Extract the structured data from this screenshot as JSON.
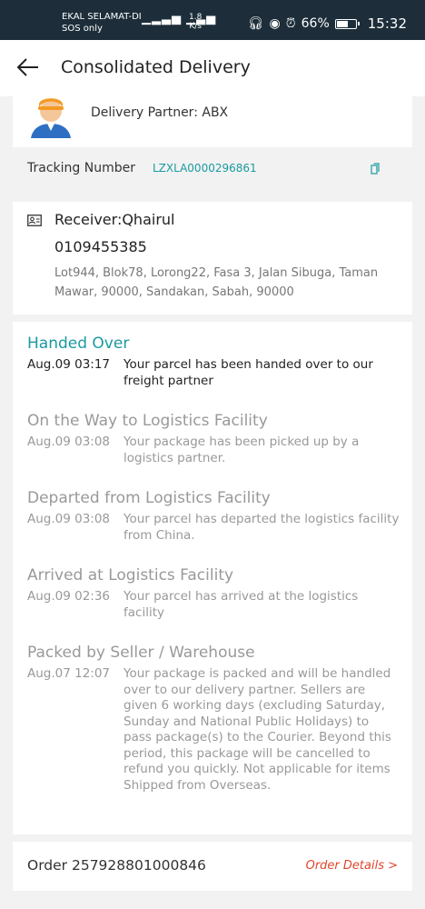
{
  "status_bar": {
    "carrier_line1": "EKAL SELAMAT-DI",
    "carrier_line2": "SOS only",
    "speed_value": "1.8",
    "speed_unit": "K/s",
    "battery": "66%",
    "battery_level": 0.66,
    "time": "15:32"
  },
  "header": {
    "title": "Consolidated Delivery"
  },
  "partner": {
    "text": "Delivery Partner: ABX"
  },
  "tracking": {
    "label": "Tracking Number",
    "number": "LZXLA0000296861"
  },
  "receiver": {
    "name": "Receiver:Qhairul",
    "phone": "0109455385",
    "address": "Lot944, Blok78, Lorong22, Fasa 3, Jalan Sibuga, Taman Mawar, 90000, Sandakan, Sabah, 90000"
  },
  "timeline": [
    {
      "title": "Handed Over",
      "time": "Aug.09 03:17",
      "description": "Your parcel has been handed over to our freight partner"
    },
    {
      "title": "On the Way to Logistics Facility",
      "time": "Aug.09 03:08",
      "description": "Your package has been picked up by a logistics partner."
    },
    {
      "title": "Departed from Logistics Facility",
      "time": "Aug.09 03:08",
      "description": "Your parcel has departed the logistics facility from China."
    },
    {
      "title": "Arrived at Logistics Facility",
      "time": "Aug.09 02:36",
      "description": "Your parcel has arrived at the logistics facility"
    },
    {
      "title": "Packed by Seller / Warehouse",
      "time": "Aug.07 12:07",
      "description": "Your package is packed and will be handled over to our delivery partner. Sellers are given 6 working days (excluding Saturday, Sunday and National Public Holidays) to pass package(s) to the Courier. Beyond this period, this package will be cancelled to refund you quickly. Not applicable for items Shipped from Overseas."
    }
  ],
  "order": {
    "number": "Order 257928801000846",
    "link": "Order Details >"
  },
  "colors": {
    "accent": "#1a9aa0",
    "link": "#e0452b",
    "status_bar": "#1d2e3a"
  }
}
